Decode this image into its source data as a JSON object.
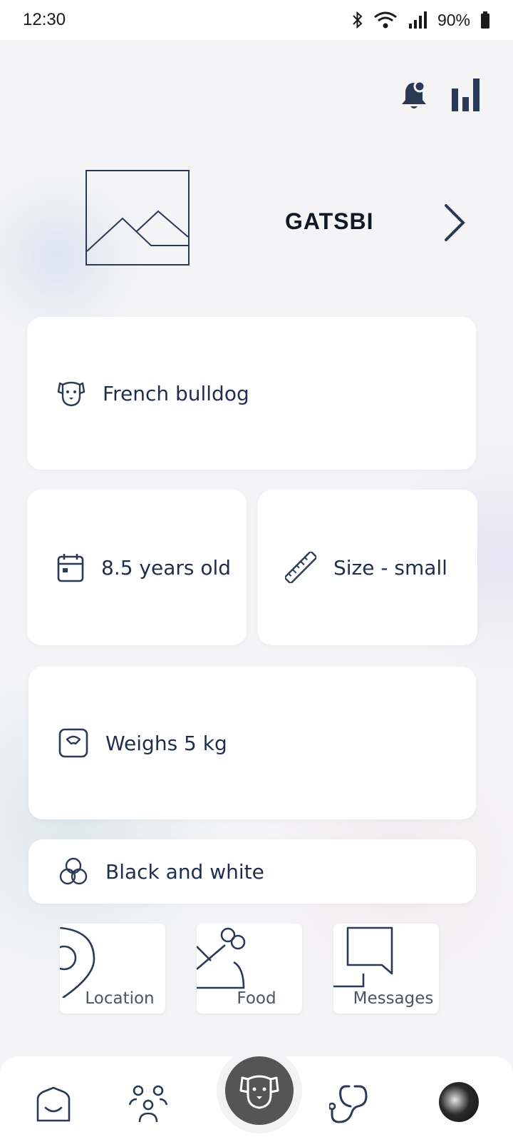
{
  "status_bar": {
    "time": "12:30",
    "battery": "90%",
    "icons": [
      "bluetooth-icon",
      "wifi-icon",
      "signal-icon",
      "battery-icon"
    ]
  },
  "header": {
    "actions": [
      "notification-bell-icon",
      "stats-chart-icon"
    ]
  },
  "pet": {
    "name": "GATSBI",
    "photo_icon": "image-placeholder-icon"
  },
  "details": {
    "breed": "French bulldog",
    "age": "8.5 years old",
    "size": "Size - small",
    "weight": "Weighs 5 kg",
    "color": "Black and white"
  },
  "shortcuts": [
    {
      "label": "Location",
      "icon": "location-pin-icon"
    },
    {
      "label": "Food",
      "icon": "food-bowl-icon"
    },
    {
      "label": "Messages",
      "icon": "chat-bubble-icon"
    }
  ],
  "bottom_nav": {
    "items": [
      "home-icon",
      "community-icon",
      "pet-icon",
      "health-icon",
      "profile-avatar"
    ],
    "active": "pet-icon",
    "colors": {
      "active_bg": "#555555",
      "icon": "#2a3a55"
    }
  }
}
